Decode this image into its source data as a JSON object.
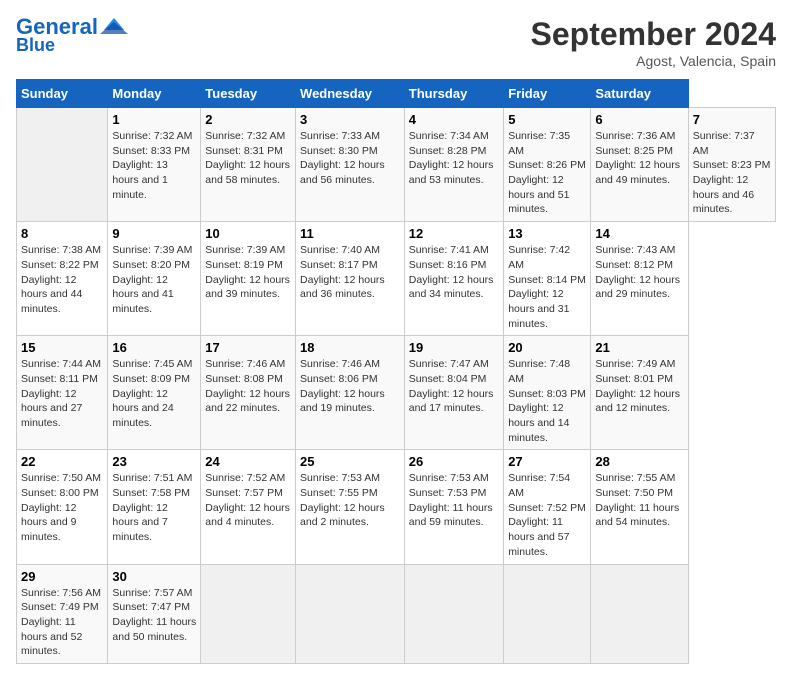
{
  "header": {
    "logo_line1": "General",
    "logo_line2": "Blue",
    "title": "September 2024",
    "subtitle": "Agost, Valencia, Spain"
  },
  "calendar": {
    "days_of_week": [
      "Sunday",
      "Monday",
      "Tuesday",
      "Wednesday",
      "Thursday",
      "Friday",
      "Saturday"
    ],
    "weeks": [
      [
        null,
        {
          "day": "1",
          "sunrise": "Sunrise: 7:32 AM",
          "sunset": "Sunset: 8:33 PM",
          "daylight": "Daylight: 13 hours and 1 minute."
        },
        {
          "day": "2",
          "sunrise": "Sunrise: 7:32 AM",
          "sunset": "Sunset: 8:31 PM",
          "daylight": "Daylight: 12 hours and 58 minutes."
        },
        {
          "day": "3",
          "sunrise": "Sunrise: 7:33 AM",
          "sunset": "Sunset: 8:30 PM",
          "daylight": "Daylight: 12 hours and 56 minutes."
        },
        {
          "day": "4",
          "sunrise": "Sunrise: 7:34 AM",
          "sunset": "Sunset: 8:28 PM",
          "daylight": "Daylight: 12 hours and 53 minutes."
        },
        {
          "day": "5",
          "sunrise": "Sunrise: 7:35 AM",
          "sunset": "Sunset: 8:26 PM",
          "daylight": "Daylight: 12 hours and 51 minutes."
        },
        {
          "day": "6",
          "sunrise": "Sunrise: 7:36 AM",
          "sunset": "Sunset: 8:25 PM",
          "daylight": "Daylight: 12 hours and 49 minutes."
        },
        {
          "day": "7",
          "sunrise": "Sunrise: 7:37 AM",
          "sunset": "Sunset: 8:23 PM",
          "daylight": "Daylight: 12 hours and 46 minutes."
        }
      ],
      [
        {
          "day": "8",
          "sunrise": "Sunrise: 7:38 AM",
          "sunset": "Sunset: 8:22 PM",
          "daylight": "Daylight: 12 hours and 44 minutes."
        },
        {
          "day": "9",
          "sunrise": "Sunrise: 7:39 AM",
          "sunset": "Sunset: 8:20 PM",
          "daylight": "Daylight: 12 hours and 41 minutes."
        },
        {
          "day": "10",
          "sunrise": "Sunrise: 7:39 AM",
          "sunset": "Sunset: 8:19 PM",
          "daylight": "Daylight: 12 hours and 39 minutes."
        },
        {
          "day": "11",
          "sunrise": "Sunrise: 7:40 AM",
          "sunset": "Sunset: 8:17 PM",
          "daylight": "Daylight: 12 hours and 36 minutes."
        },
        {
          "day": "12",
          "sunrise": "Sunrise: 7:41 AM",
          "sunset": "Sunset: 8:16 PM",
          "daylight": "Daylight: 12 hours and 34 minutes."
        },
        {
          "day": "13",
          "sunrise": "Sunrise: 7:42 AM",
          "sunset": "Sunset: 8:14 PM",
          "daylight": "Daylight: 12 hours and 31 minutes."
        },
        {
          "day": "14",
          "sunrise": "Sunrise: 7:43 AM",
          "sunset": "Sunset: 8:12 PM",
          "daylight": "Daylight: 12 hours and 29 minutes."
        }
      ],
      [
        {
          "day": "15",
          "sunrise": "Sunrise: 7:44 AM",
          "sunset": "Sunset: 8:11 PM",
          "daylight": "Daylight: 12 hours and 27 minutes."
        },
        {
          "day": "16",
          "sunrise": "Sunrise: 7:45 AM",
          "sunset": "Sunset: 8:09 PM",
          "daylight": "Daylight: 12 hours and 24 minutes."
        },
        {
          "day": "17",
          "sunrise": "Sunrise: 7:46 AM",
          "sunset": "Sunset: 8:08 PM",
          "daylight": "Daylight: 12 hours and 22 minutes."
        },
        {
          "day": "18",
          "sunrise": "Sunrise: 7:46 AM",
          "sunset": "Sunset: 8:06 PM",
          "daylight": "Daylight: 12 hours and 19 minutes."
        },
        {
          "day": "19",
          "sunrise": "Sunrise: 7:47 AM",
          "sunset": "Sunset: 8:04 PM",
          "daylight": "Daylight: 12 hours and 17 minutes."
        },
        {
          "day": "20",
          "sunrise": "Sunrise: 7:48 AM",
          "sunset": "Sunset: 8:03 PM",
          "daylight": "Daylight: 12 hours and 14 minutes."
        },
        {
          "day": "21",
          "sunrise": "Sunrise: 7:49 AM",
          "sunset": "Sunset: 8:01 PM",
          "daylight": "Daylight: 12 hours and 12 minutes."
        }
      ],
      [
        {
          "day": "22",
          "sunrise": "Sunrise: 7:50 AM",
          "sunset": "Sunset: 8:00 PM",
          "daylight": "Daylight: 12 hours and 9 minutes."
        },
        {
          "day": "23",
          "sunrise": "Sunrise: 7:51 AM",
          "sunset": "Sunset: 7:58 PM",
          "daylight": "Daylight: 12 hours and 7 minutes."
        },
        {
          "day": "24",
          "sunrise": "Sunrise: 7:52 AM",
          "sunset": "Sunset: 7:57 PM",
          "daylight": "Daylight: 12 hours and 4 minutes."
        },
        {
          "day": "25",
          "sunrise": "Sunrise: 7:53 AM",
          "sunset": "Sunset: 7:55 PM",
          "daylight": "Daylight: 12 hours and 2 minutes."
        },
        {
          "day": "26",
          "sunrise": "Sunrise: 7:53 AM",
          "sunset": "Sunset: 7:53 PM",
          "daylight": "Daylight: 11 hours and 59 minutes."
        },
        {
          "day": "27",
          "sunrise": "Sunrise: 7:54 AM",
          "sunset": "Sunset: 7:52 PM",
          "daylight": "Daylight: 11 hours and 57 minutes."
        },
        {
          "day": "28",
          "sunrise": "Sunrise: 7:55 AM",
          "sunset": "Sunset: 7:50 PM",
          "daylight": "Daylight: 11 hours and 54 minutes."
        }
      ],
      [
        {
          "day": "29",
          "sunrise": "Sunrise: 7:56 AM",
          "sunset": "Sunset: 7:49 PM",
          "daylight": "Daylight: 11 hours and 52 minutes."
        },
        {
          "day": "30",
          "sunrise": "Sunrise: 7:57 AM",
          "sunset": "Sunset: 7:47 PM",
          "daylight": "Daylight: 11 hours and 50 minutes."
        },
        null,
        null,
        null,
        null,
        null
      ]
    ]
  }
}
